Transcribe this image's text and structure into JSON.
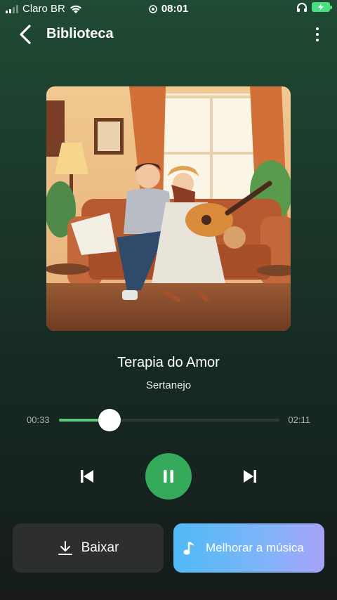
{
  "status_bar": {
    "carrier": "Claro BR",
    "time": "08:01"
  },
  "header": {
    "title": "Biblioteca"
  },
  "track": {
    "title": "Terapia do Amor",
    "genre": "Sertanejo",
    "current_time": "00:33",
    "total_time": "02:11",
    "progress_fraction": 0.23
  },
  "actions": {
    "download_label": "Baixar",
    "enhance_label": "Melhorar a música"
  },
  "colors": {
    "accent": "#36a95a",
    "progress": "#5cc77a"
  }
}
